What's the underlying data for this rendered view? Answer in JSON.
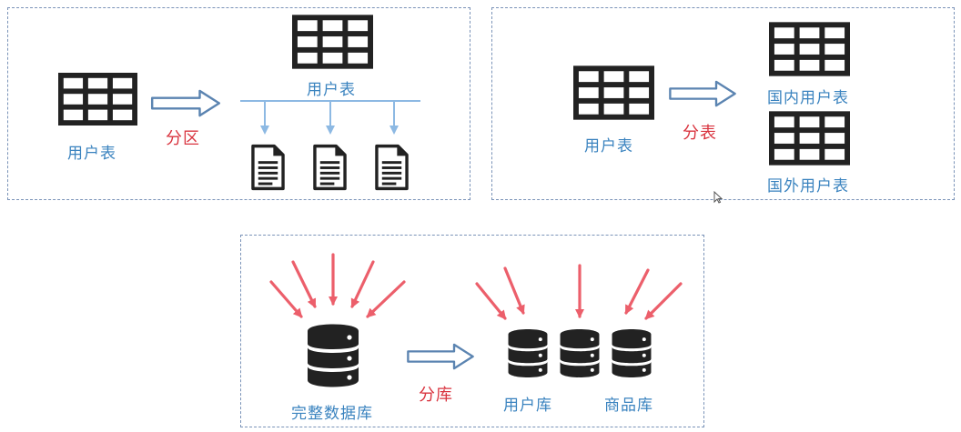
{
  "partition": {
    "source_label": "用户表",
    "target_label": "用户表",
    "action_label": "分区"
  },
  "table_split": {
    "source_label": "用户表",
    "action_label": "分表",
    "domestic_label": "国内用户表",
    "foreign_label": "国外用户表"
  },
  "db_split": {
    "source_label": "完整数据库",
    "action_label": "分库",
    "user_db_label": "用户库",
    "product_db_label": "商品库"
  },
  "colors": {
    "label_blue": "#3a83bf",
    "action_red": "#d9343f",
    "arrow_outline": "#5b84b1",
    "branch_line": "#8db9e3",
    "request_arrow": "#ec5f6b",
    "panel_border": "#7a93b8",
    "icon_dark": "#222222"
  },
  "icons": [
    "table-grid-icon",
    "document-icon",
    "database-icon",
    "hollow-right-arrow-icon",
    "request-arrow-icon"
  ]
}
